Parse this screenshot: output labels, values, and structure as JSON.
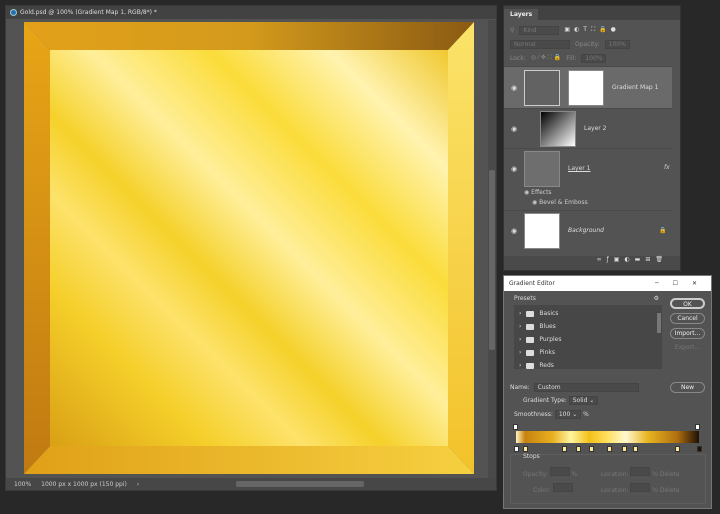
{
  "document": {
    "title": "Gold.psd @ 100% (Gradient Map 1, RGB/8*) *",
    "zoom": "100%",
    "doc_info": "1000 px x 1000 px (150 ppi)"
  },
  "layers_panel": {
    "tab": "Layers",
    "filter_placeholder": "Kind",
    "blend_mode": "Normal",
    "opacity_label": "Opacity:",
    "opacity": "100%",
    "lock_label": "Lock:",
    "fill_label": "Fill:",
    "fill": "100%",
    "layers": [
      {
        "name": "Gradient Map 1"
      },
      {
        "name": "Layer 2"
      },
      {
        "name": "Layer 1",
        "fx": "fx"
      },
      {
        "name": "Background"
      }
    ],
    "effects_label": "Effects",
    "effect": "Bevel & Emboss"
  },
  "gradient_editor": {
    "title": "Gradient Editor",
    "presets_label": "Presets",
    "presets": [
      "Basics",
      "Blues",
      "Purples",
      "Pinks",
      "Reds"
    ],
    "ok": "OK",
    "cancel": "Cancel",
    "import": "Import...",
    "export": "Export...",
    "name_label": "Name:",
    "name": "Custom",
    "new": "New",
    "type_label": "Gradient Type:",
    "type": "Solid",
    "smoothness_label": "Smoothness:",
    "smoothness": "100",
    "pct": "%",
    "stops_label": "Stops",
    "opacity_label": "Opacity:",
    "color_label": "Color:",
    "location_label": "Location:",
    "delete": "Delete",
    "color_stops_pct": [
      0,
      5,
      26,
      34,
      41,
      51,
      59,
      65,
      88,
      100
    ]
  }
}
